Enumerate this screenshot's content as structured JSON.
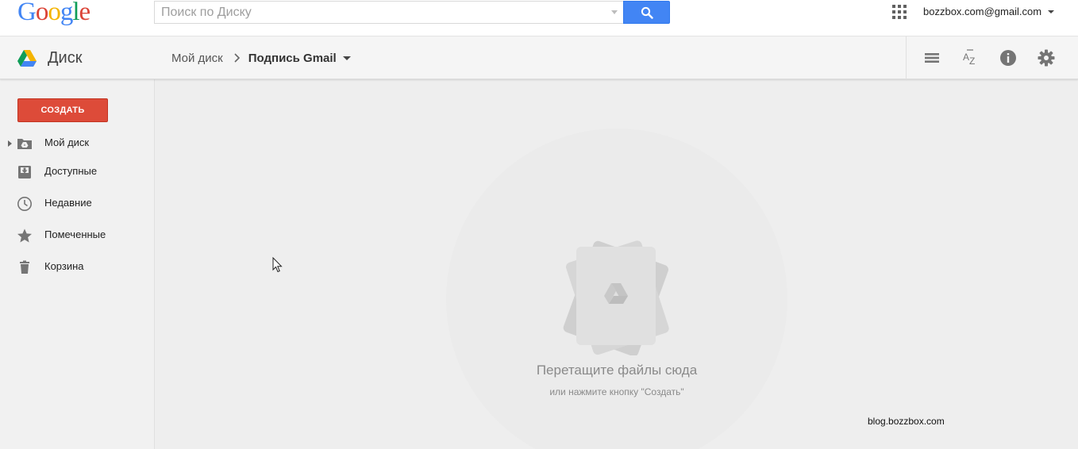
{
  "colors": {
    "google_blue": "#4285f4",
    "google_red": "#db4437",
    "google_yellow": "#f4b400",
    "google_green": "#0f9d58",
    "create_button": "#dd4b39",
    "main_background": "#eeeeee",
    "sidebar_background": "#f1f1f1"
  },
  "header": {
    "logo_letters": [
      "G",
      "o",
      "o",
      "g",
      "l",
      "e"
    ],
    "search": {
      "placeholder": "Поиск по Диску",
      "value": "",
      "button_icon": "search-icon"
    },
    "apps_icon": "apps-grid-icon",
    "account": "bozzbox.com@gmail.com"
  },
  "subbar": {
    "product_name": "Диск",
    "breadcrumb": {
      "root": "Мой диск",
      "current": "Подпись Gmail"
    },
    "tools": [
      "list-view-icon",
      "sort-az-icon",
      "info-icon",
      "settings-gear-icon"
    ]
  },
  "sidebar": {
    "create_label": "СОЗДАТЬ",
    "items": [
      {
        "label": "Мой диск",
        "icon": "my-drive-folder-icon"
      },
      {
        "label": "Доступные",
        "icon": "shared-inbox-icon"
      },
      {
        "label": "Недавние",
        "icon": "clock-icon"
      },
      {
        "label": "Помеченные",
        "icon": "star-icon"
      },
      {
        "label": "Корзина",
        "icon": "trash-icon"
      }
    ]
  },
  "main": {
    "empty_title": "Перетащите файлы сюда",
    "empty_subtitle": "или нажмите кнопку \"Создать\"",
    "watermark": "blog.bozzbox.com"
  }
}
